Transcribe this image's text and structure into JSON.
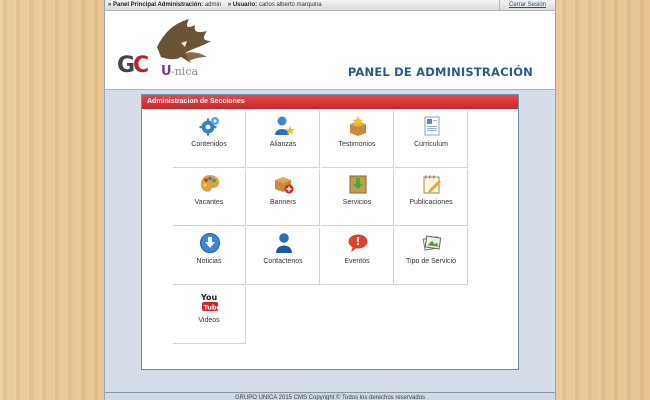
{
  "topbar": {
    "panel_label": "» Panel Principal Administración:",
    "panel_user": "admin",
    "user_label": "» Usuario:",
    "user_name": "carlos alberto marquina",
    "logout": "Cerrar Sesión"
  },
  "header": {
    "logo_letters": "GC",
    "logo_word": "U-nica",
    "title": "PANEL DE ADMINISTRACIÓN"
  },
  "sections": {
    "title": "Administracion de Secciones",
    "items": [
      {
        "label": "Contenidos",
        "icon": "gears-icon"
      },
      {
        "label": "Alianzas",
        "icon": "user-star-icon"
      },
      {
        "label": "Testimonios",
        "icon": "box-star-icon"
      },
      {
        "label": "Curriculum",
        "icon": "document-icon"
      },
      {
        "label": "Vacantes",
        "icon": "palette-icon"
      },
      {
        "label": "Banners",
        "icon": "box-add-icon"
      },
      {
        "label": "Servicios",
        "icon": "download-box-icon"
      },
      {
        "label": "Publicaciones",
        "icon": "notepad-pencil-icon"
      },
      {
        "label": "Noticias",
        "icon": "download-circle-icon"
      },
      {
        "label": "Contactenos",
        "icon": "person-icon"
      },
      {
        "label": "Eventos",
        "icon": "speech-bubble-icon"
      },
      {
        "label": "Tipo de Servicio",
        "icon": "photos-icon"
      },
      {
        "label": "Videos",
        "icon": "youtube-icon"
      }
    ]
  },
  "footer": {
    "text": "GRUPO UNICA 2015 CMS Copyright © Todos los derechos reservados"
  },
  "colors": {
    "accent": "#2b5a8a",
    "header_red": "#d5393c",
    "content_bg": "#d5dee8"
  }
}
